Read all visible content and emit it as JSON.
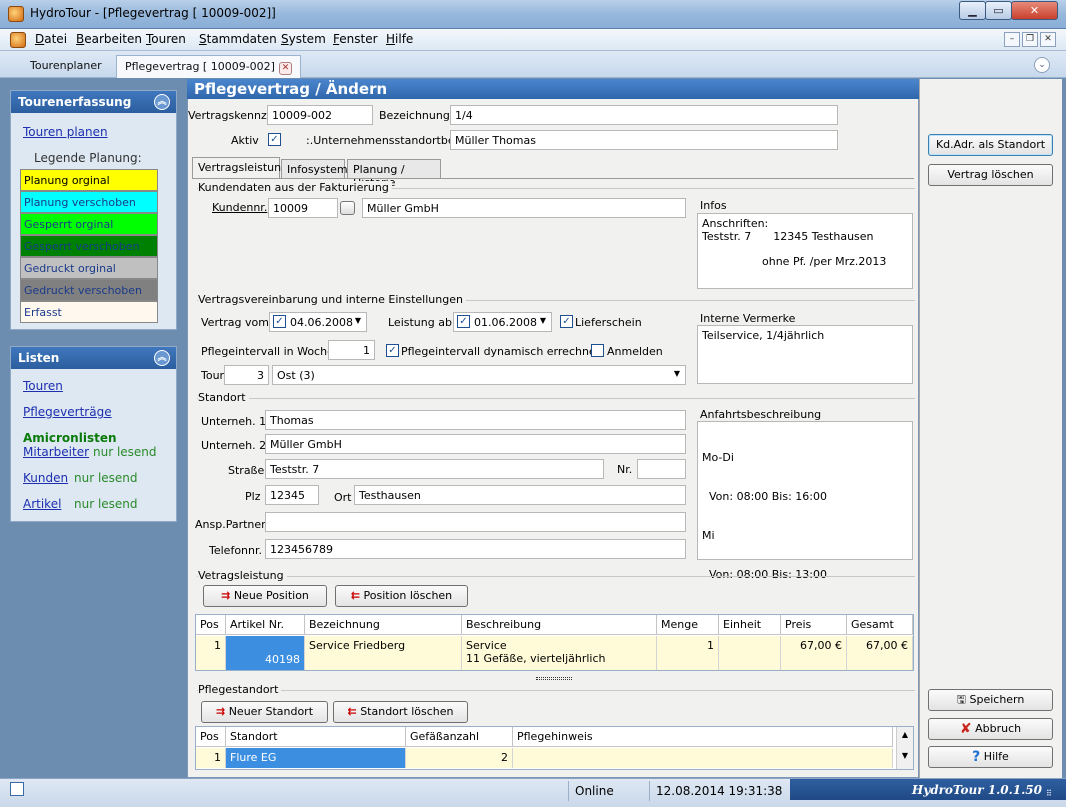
{
  "window": {
    "title": "HydroTour - [Pflegevertrag [  10009-002]]"
  },
  "menu": [
    {
      "label": "Datei",
      "key": "D",
      "rest": "atei"
    },
    {
      "label": "Bearbeiten",
      "key": "B",
      "rest": "earbeiten"
    },
    {
      "label": "Touren",
      "key": "T",
      "rest": "ouren"
    },
    {
      "label": "Stammdaten",
      "key": "S",
      "rest": "tammdaten"
    },
    {
      "label": "System",
      "key": "S",
      "rest": "ystem"
    },
    {
      "label": "Fenster",
      "key": "F",
      "rest": "enster"
    },
    {
      "label": "Hilfe",
      "key": "H",
      "rest": "ilfe"
    }
  ],
  "doc_tabs": {
    "t1": "Tourenplaner",
    "t2": "Pflegevertrag [  10009-002]"
  },
  "sidebar": {
    "tourenerfassung": {
      "title": "Tourenerfassung",
      "touren_planen": "Touren planen",
      "legende_title": "Legende Planung:",
      "legend": [
        {
          "label": "Planung orginal",
          "bg": "#ffff00",
          "fg": "#000000"
        },
        {
          "label": "Planung verschoben",
          "bg": "#00ffff",
          "fg": "#1a3a8a"
        },
        {
          "label": "Gesperrt orginal",
          "bg": "#00ff00",
          "fg": "#1a3a8a"
        },
        {
          "label": "Gesperrt verschoben",
          "bg": "#008000",
          "fg": "#1a3a8a"
        },
        {
          "label": "Gedruckt orginal",
          "bg": "#c0c0c0",
          "fg": "#1a3a8a"
        },
        {
          "label": "Gedruckt verschoben",
          "bg": "#808080",
          "fg": "#1a3a8a"
        },
        {
          "label": "Erfasst",
          "bg": "#fff8ee",
          "fg": "#1a3a8a"
        }
      ]
    },
    "listen": {
      "title": "Listen",
      "touren": "Touren",
      "pflegevertraege": "Pflegeverträge",
      "amicronlisten": "Amicronlisten",
      "mitarbeiter": "Mitarbeiter",
      "kunden": "Kunden",
      "artikel": "Artikel",
      "nur_lesend": "nur lesend"
    }
  },
  "header": {
    "title": "Pflegevertrag / Ändern"
  },
  "form": {
    "vertragskennz_label": "Vertragskennz.",
    "vertragskennz_value": "10009-002",
    "bezeichnung_label": "Bezeichnung:",
    "bezeichnung_value": "1/4",
    "aktiv_label": "Aktiv",
    "unternehmensstandort_label": ":.Unternehmensstandortbez",
    "unternehmensstandort_value": "Müller Thomas"
  },
  "subtabs": {
    "vertragsleistung": "Vertragsleistung",
    "infosystem": "Infosystem",
    "planung": "Planung / Historie"
  },
  "kundendaten": {
    "group_title": "Kundendaten aus der Fakturierung",
    "kundennr_label": "Kundennr.",
    "kundennr_value": "10009",
    "kunde_name": "Müller GmbH",
    "infos_label": "Infos",
    "infos_line1": "Anschriften:",
    "infos_line2a": "Teststr. 7",
    "infos_line2b": "12345 Testhausen",
    "infos_line3": "ohne Pf.  /per Mrz.2013"
  },
  "vereinbarung": {
    "group_title": "Vertragsvereinbarung und interne Einstellungen",
    "vertrag_vom_label": "Vertrag vom",
    "vertrag_vom_value": "04.06.2008",
    "leistung_ab_label": "Leistung ab",
    "leistung_ab_value": "01.06.2008",
    "lieferschein_label": "Lieferschein",
    "pflegeintervall_label": "Pflegeintervall in Wochen",
    "pflegeintervall_value": "1",
    "dynamisch_label": "Pflegeintervall dynamisch errechnen",
    "anmelden_label": "Anmelden",
    "tour_label": "Tour",
    "tour_nr": "3",
    "tour_value": "Ost (3)",
    "interne_vermerke_label": "Interne Vermerke",
    "interne_vermerke_value": "Teilservice, 1/4jährlich"
  },
  "standort": {
    "group_title": "Standort",
    "unterneh1_label": "Unterneh. 1",
    "unterneh1_value": "Thomas",
    "unterneh2_label": "Unterneh. 2",
    "unterneh2_value": "Müller GmbH",
    "strasse_label": "Straße",
    "strasse_value": "Teststr. 7",
    "nr_label": "Nr.",
    "nr_value": "",
    "plz_label": "Plz",
    "plz_value": "12345",
    "ort_label": "Ort",
    "ort_value": "Testhausen",
    "ansp_label": "Ansp.Partner",
    "ansp_value": "",
    "telefon_label": "Telefonnr.",
    "telefon_value": "123456789",
    "anfahrt_label": "Anfahrtsbeschreibung",
    "anfahrt_lines": [
      "Mo-Di",
      "  Von: 08:00 Bis: 16:00",
      "Mi",
      "  Von: 08:00 Bis: 13:00"
    ]
  },
  "vertragsleistung": {
    "group_title": "Vetragsleistung",
    "neue_position": "Neue Position",
    "position_loeschen": "Position löschen",
    "columns": [
      "Pos",
      "Artikel Nr.",
      "Bezeichnung",
      "Beschreibung",
      "Menge",
      "Einheit",
      "Preis",
      "Gesamt"
    ],
    "row": {
      "pos": "1",
      "artikel_nr": "40198",
      "bezeichnung": "Service Friedberg",
      "beschreibung_1": "Service",
      "beschreibung_2": "11 Gefäße, vierteljährlich",
      "menge": "1",
      "einheit": "",
      "preis": "67,00 €",
      "gesamt": "67,00 €"
    }
  },
  "pflegestandort": {
    "group_title": "Pflegestandort",
    "neuer_standort": "Neuer Standort",
    "standort_loeschen": "Standort löschen",
    "columns": [
      "Pos",
      "Standort",
      "Gefäßanzahl",
      "Pflegehinweis"
    ],
    "row": {
      "pos": "1",
      "standort": "Flure EG",
      "anzahl": "2",
      "hinweis": ""
    }
  },
  "right_buttons": {
    "kd_adr": "Kd.Adr. als Standort",
    "vertrag_loeschen": "Vertrag  löschen",
    "speichern": "Speichern",
    "abbruch": "Abbruch",
    "hilfe": "Hilfe"
  },
  "status": {
    "online": "Online",
    "datetime": "12.08.2014 19:31:38",
    "brand": "HydroTour 1.0.1.50"
  }
}
